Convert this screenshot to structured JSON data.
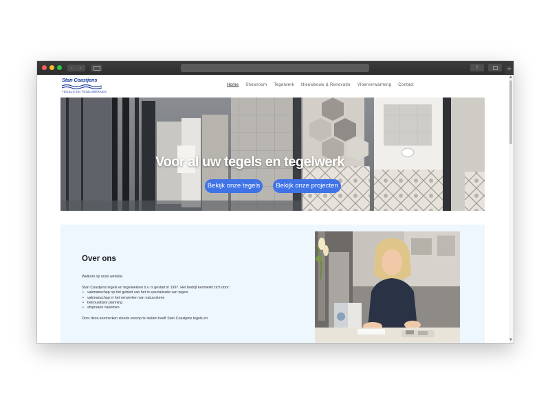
{
  "browser": {
    "back_icon": "‹",
    "forward_icon": "›",
    "share_icon": "⇪",
    "newtab_icon": "+"
  },
  "site": {
    "logo": {
      "name": "Stan Coastjens",
      "tagline": "TEGELS EN TEGELWERKEN",
      "color": "#1c3f9e"
    },
    "nav": [
      {
        "label": "Home",
        "active": true
      },
      {
        "label": "Showroom"
      },
      {
        "label": "Tegelwerk"
      },
      {
        "label": "Nieuwbouw & Renovatie"
      },
      {
        "label": "Vloerverwarming"
      },
      {
        "label": "Contact"
      }
    ]
  },
  "hero": {
    "title": "Voor al uw tegels en tegelwerk",
    "buttons": [
      {
        "label": "Bekijk onze tegels"
      },
      {
        "label": "Bekijk onze projecten"
      }
    ],
    "accent": "#3f73e6"
  },
  "about": {
    "title": "Over ons",
    "intro": "Welkom op onze website.",
    "para": "Stan Coastjens tegels en tegelwerken b.v. is gestart in 1997. Het bedrijf kenmerkt zich door:",
    "bullets": [
      "vakmanschap op het gebied van het in specialisatie van tegels",
      "vakmanschap in het verwerken van natuursteen",
      "betrouwbare planning",
      "afspraken nakomen."
    ],
    "closing": "Door deze kenmerken steeds voorop te stellen heeft Stan Coastjens tegels en",
    "background": "#eef6fe"
  }
}
